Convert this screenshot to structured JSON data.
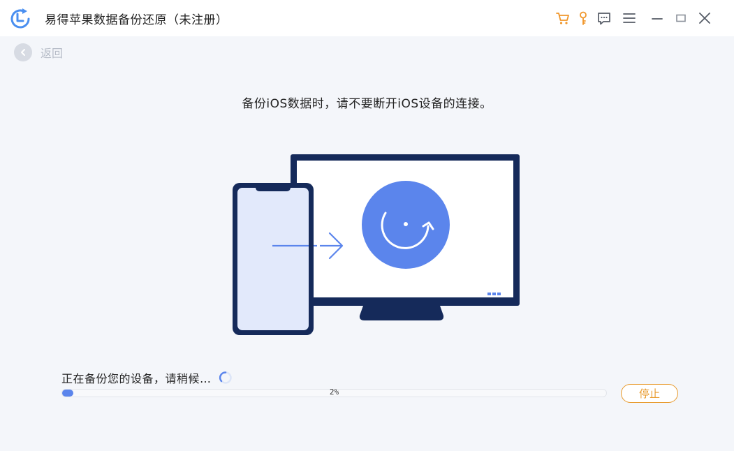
{
  "app": {
    "title": "易得苹果数据备份还原（未注册）"
  },
  "titlebar": {
    "icons": [
      "cart-icon",
      "key-icon",
      "feedback-icon",
      "menu-icon",
      "minimize-icon",
      "maximize-icon",
      "close-icon"
    ],
    "accent_color": "#f0962a"
  },
  "nav": {
    "back_label": "返回"
  },
  "main": {
    "instruction": "备份iOS数据时，请不要断开iOS设备的连接。",
    "status_text": "正在备份您的设备，请稍候…",
    "progress": {
      "value": 2,
      "label": "2%"
    },
    "stop_label": "停止"
  },
  "colors": {
    "brand_blue": "#5b85ec",
    "navy": "#152a5a",
    "stop_orange": "#e89a2c"
  }
}
